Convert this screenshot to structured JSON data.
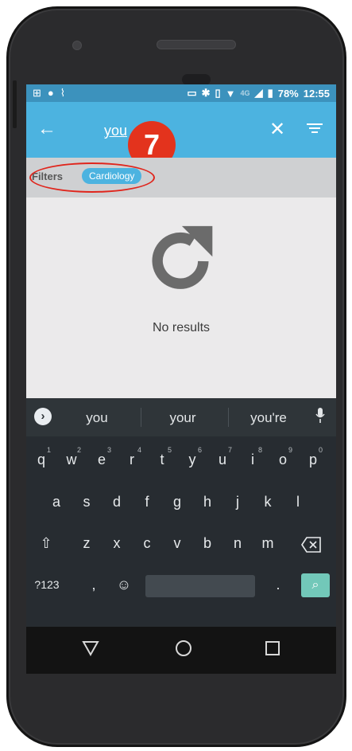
{
  "status_bar": {
    "battery": "78%",
    "time": "12:55",
    "network": "4G"
  },
  "app_bar": {
    "back_icon": "arrow-left-icon",
    "query": "you",
    "clear_icon": "close-icon",
    "filter_icon": "filter-icon"
  },
  "annotation": {
    "step_number": "7",
    "color": "#e3331d"
  },
  "filters": {
    "label": "Filters",
    "chips": [
      "Cardiology"
    ]
  },
  "content": {
    "icon": "refresh-icon",
    "message": "No results"
  },
  "keyboard": {
    "suggestions": [
      "you",
      "your",
      "you're"
    ],
    "row1": [
      {
        "key": "q",
        "alt": "1"
      },
      {
        "key": "w",
        "alt": "2"
      },
      {
        "key": "e",
        "alt": "3"
      },
      {
        "key": "r",
        "alt": "4"
      },
      {
        "key": "t",
        "alt": "5"
      },
      {
        "key": "y",
        "alt": "6"
      },
      {
        "key": "u",
        "alt": "7"
      },
      {
        "key": "i",
        "alt": "8"
      },
      {
        "key": "o",
        "alt": "9"
      },
      {
        "key": "p",
        "alt": "0"
      }
    ],
    "row2": [
      "a",
      "s",
      "d",
      "f",
      "g",
      "h",
      "j",
      "k",
      "l"
    ],
    "row3": [
      "z",
      "x",
      "c",
      "v",
      "b",
      "n",
      "m"
    ],
    "row4": {
      "symbols": "?123",
      "comma": ",",
      "emoji": "☺",
      "period": ".",
      "search_icon": "search-icon"
    },
    "accent_color": "#72c8b9"
  },
  "colors": {
    "appbar": "#4cb3e0",
    "statusbar": "#3c92bd"
  }
}
